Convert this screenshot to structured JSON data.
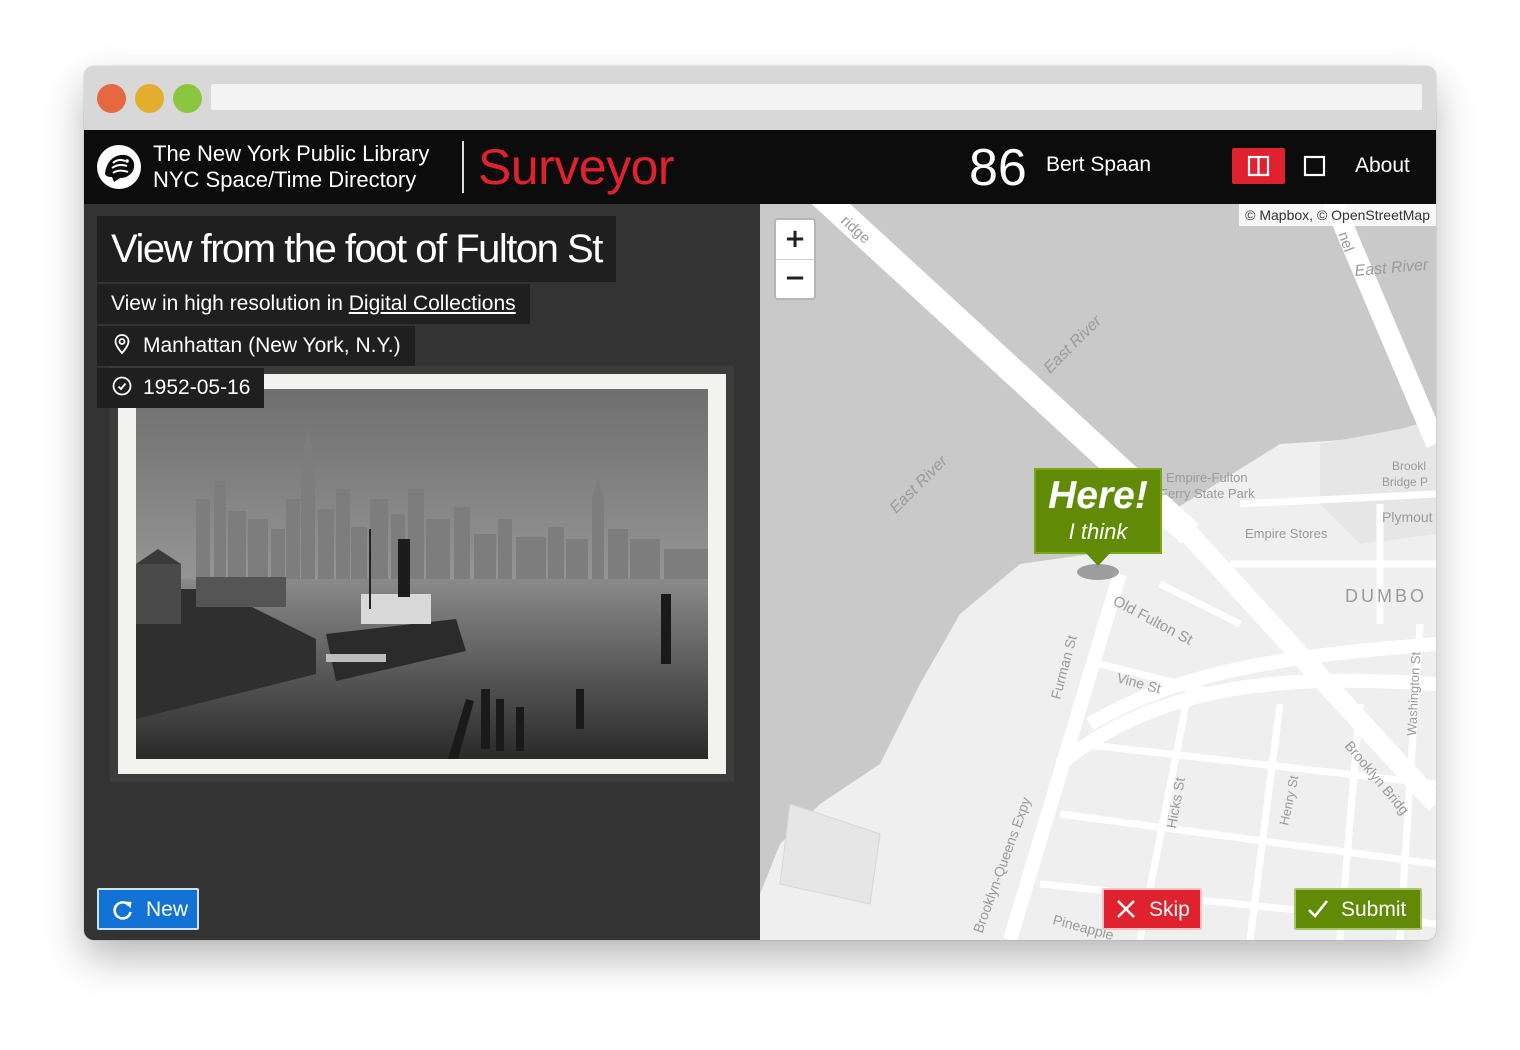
{
  "app": {
    "org_line1": "The New York Public Library",
    "org_line2": "NYC Space/Time Directory",
    "name": "Surveyor",
    "score": "86",
    "user": "Bert Spaan",
    "nav_about": "About",
    "accent_color": "#e0222e"
  },
  "item": {
    "title": "View from the foot of Fulton St",
    "hires_prefix": "View in high resolution in ",
    "hires_link": "Digital Collections",
    "location": "Manhattan (New York, N.Y.)",
    "date": "1952-05-16"
  },
  "buttons": {
    "new": "New",
    "skip": "Skip",
    "submit": "Submit",
    "zoom_in": "+",
    "zoom_out": "−"
  },
  "map": {
    "attribution": "© Mapbox, © OpenStreetMap",
    "marker_title": "Here!",
    "marker_subtitle": "I think",
    "labels": {
      "bridge_top": "ridge",
      "tunnel_top": "nel",
      "east_river_1": "East River",
      "east_river_2": "East River",
      "east_river_3": "East River",
      "empire_fulton_1": "Empire-Fulton",
      "empire_fulton_2": "Ferry State Park",
      "brooklyn_bridge_park_1": "Brookl",
      "brooklyn_bridge_park_2": "Bridge P",
      "plymouth": "Plymout",
      "empire_stores": "Empire Stores",
      "dumbo": "DUMBO",
      "old_fulton": "Old Fulton St",
      "vine": "Vine St",
      "furman": "Furman St",
      "washington": "Washington St",
      "bqe": "Brooklyn-Queens Expy",
      "hicks": "Hicks St",
      "henry": "Henry St",
      "brooklyn_bridge": "Brooklyn Bridg",
      "pineapple": "Pineapple"
    }
  },
  "icons": {
    "logo": "nypl-lion-icon",
    "location": "map-pin-icon",
    "date": "clock-icon",
    "refresh": "refresh-icon",
    "split": "split-view-icon",
    "single": "single-view-icon",
    "skip": "close-icon",
    "submit": "check-icon"
  }
}
